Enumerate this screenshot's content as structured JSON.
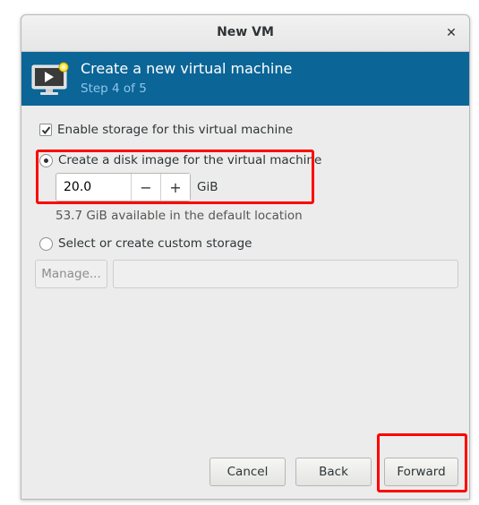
{
  "window": {
    "title": "New VM",
    "close_glyph": "✕"
  },
  "banner": {
    "title": "Create a new virtual machine",
    "step": "Step 4 of 5",
    "icon": "vm-monitor-icon",
    "background": "#0b6597"
  },
  "storage": {
    "enable_label": "Enable storage for this virtual machine",
    "enable_checked": true,
    "disk_image_label": "Create a disk image for the virtual machine",
    "disk_image_selected": true,
    "size_value": "20.0",
    "decrement_glyph": "−",
    "increment_glyph": "+",
    "unit": "GiB",
    "available_text": "53.7 GiB available in the default location",
    "custom_label": "Select or create custom storage",
    "custom_selected": false,
    "manage_label": "Manage...",
    "custom_path_value": ""
  },
  "footer": {
    "cancel_label": "Cancel",
    "back_label": "Back",
    "forward_label": "Forward"
  },
  "annotations": {
    "highlight_color": "#ff0000"
  }
}
